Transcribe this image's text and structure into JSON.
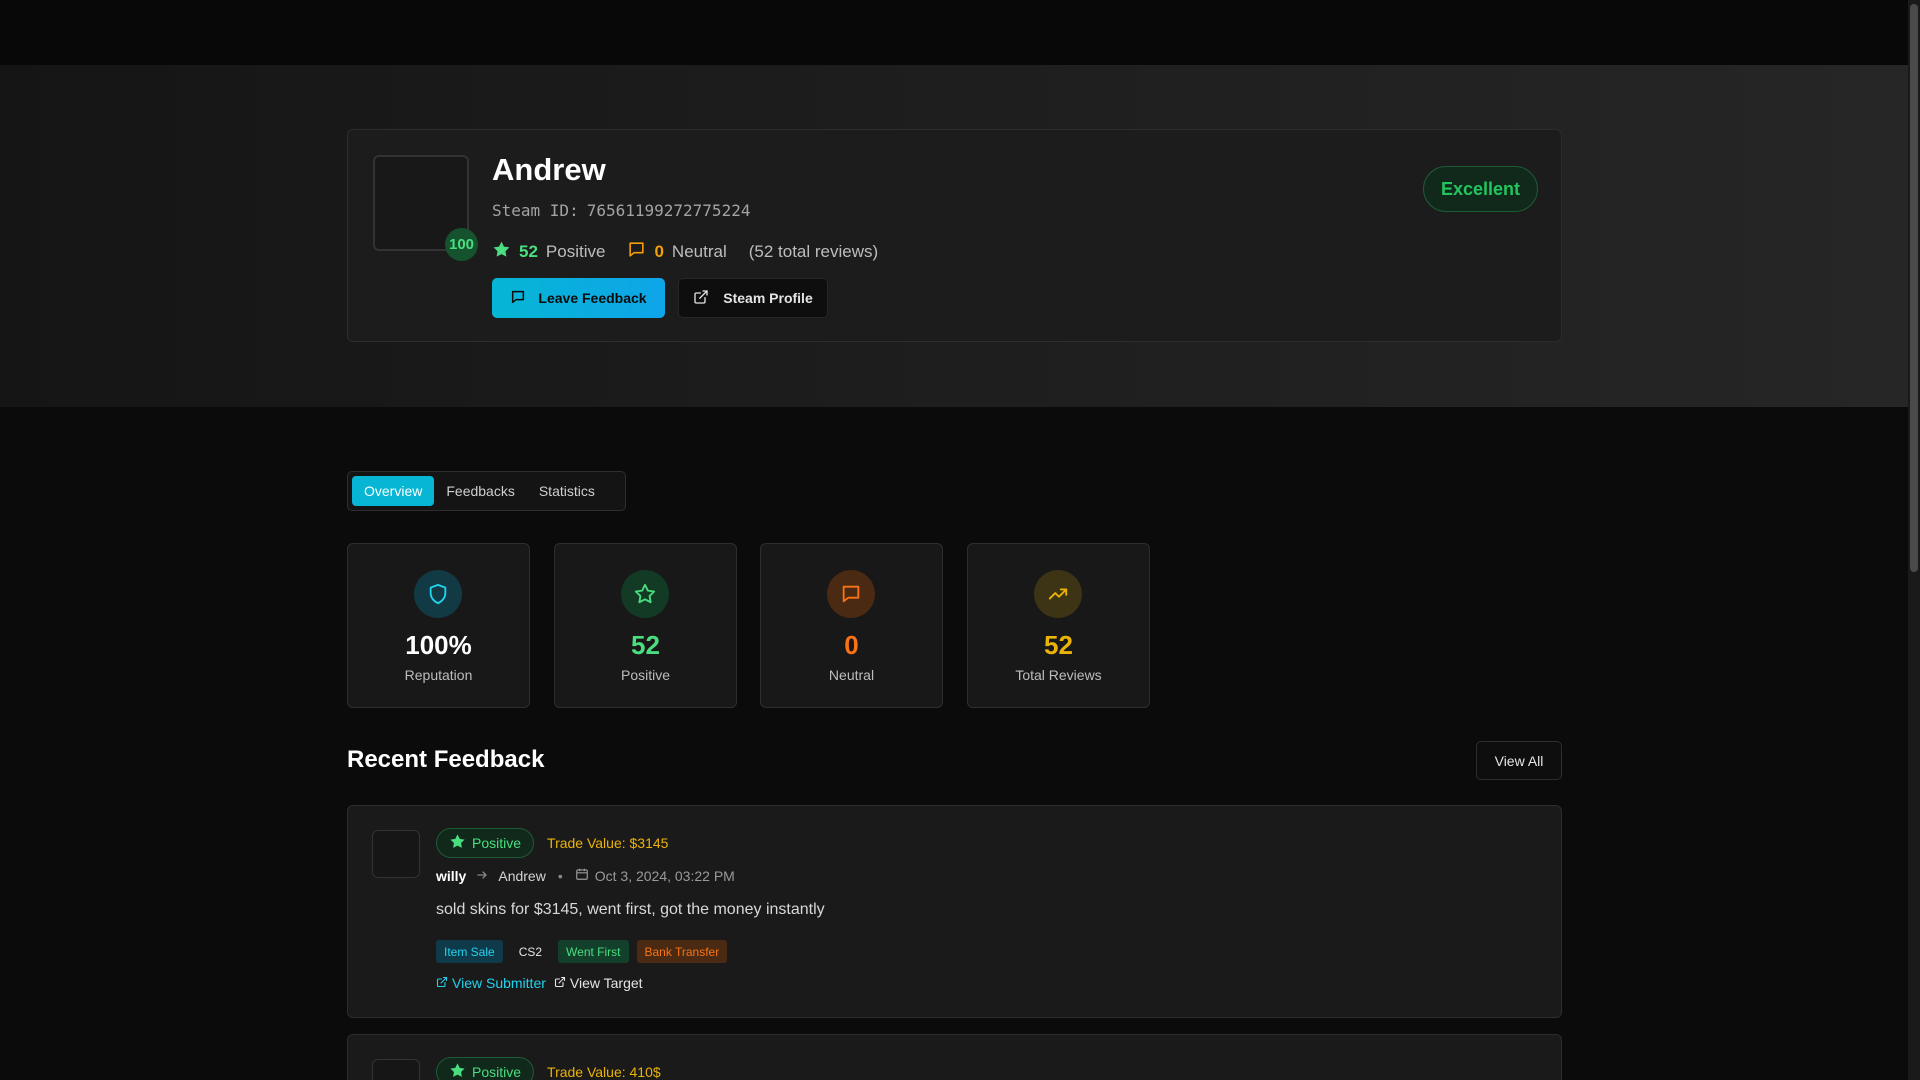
{
  "profile": {
    "name": "Andrew",
    "steam_id_label": "Steam ID:",
    "steam_id": "76561199272775224",
    "avatar_score": "100",
    "positive_count": "52",
    "positive_label": "Positive",
    "neutral_count": "0",
    "neutral_label": "Neutral",
    "total_reviews_text": "(52 total reviews)",
    "rating_badge": "Excellent",
    "leave_feedback_label": "Leave Feedback",
    "steam_profile_label": "Steam Profile"
  },
  "tabs": [
    {
      "label": "Overview",
      "active": true
    },
    {
      "label": "Feedbacks",
      "active": false
    },
    {
      "label": "Statistics",
      "active": false
    }
  ],
  "stats": [
    {
      "value": "100%",
      "label": "Reputation",
      "icon": "shield-icon",
      "color": "#ffffff",
      "icon_color": "#22d3ee",
      "icon_bg": "#123a45"
    },
    {
      "value": "52",
      "label": "Positive",
      "icon": "star-icon",
      "color": "#4ade80",
      "icon_color": "#4ade80",
      "icon_bg": "#123a24"
    },
    {
      "value": "0",
      "label": "Neutral",
      "icon": "message-icon",
      "color": "#f97316",
      "icon_color": "#f97316",
      "icon_bg": "#4a2a12"
    },
    {
      "value": "52",
      "label": "Total Reviews",
      "icon": "trending-up-icon",
      "color": "#eab308",
      "icon_color": "#eab308",
      "icon_bg": "#3d3415"
    }
  ],
  "recent": {
    "title": "Recent Feedback",
    "view_all_label": "View All"
  },
  "feedbacks": [
    {
      "sentiment": "Positive",
      "trade_value": "Trade Value: $3145",
      "from": "willy",
      "to": "Andrew",
      "date": "Oct 3, 2024, 03:22 PM",
      "comment": "sold skins for $3145, went first, got the money instantly",
      "tags": [
        "Item Sale",
        "CS2",
        "Went First",
        "Bank Transfer"
      ],
      "view_submitter": "View Submitter",
      "view_target": "View Target"
    },
    {
      "sentiment": "Positive",
      "trade_value": "Trade Value: 410$"
    }
  ],
  "colors": {
    "accent": "#06b6d4",
    "positive": "#4ade80",
    "neutral": "#f97316",
    "gold": "#eab308"
  }
}
